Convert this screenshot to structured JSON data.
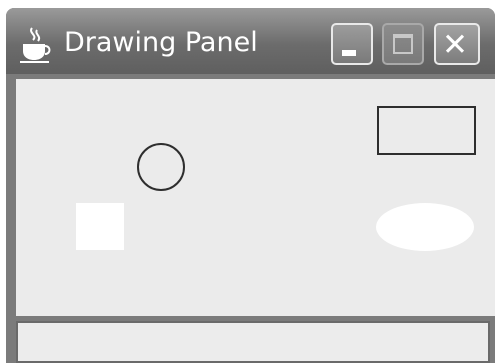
{
  "window": {
    "title": "Drawing Panel",
    "app_icon": "java-cup-icon",
    "controls": {
      "minimize_icon": "minimize-icon",
      "maximize_icon": "maximize-icon",
      "close_icon": "close-icon"
    }
  },
  "colors": {
    "titlebar": "#6c6c6c",
    "panel_background": "#ebebeb",
    "shape_stroke": "#2e2e2e",
    "shape_fill": "#ffffff"
  },
  "drawing": {
    "shapes": [
      "circle",
      "square",
      "rectangle",
      "ellipse"
    ]
  },
  "status_bar": {
    "text": ""
  }
}
